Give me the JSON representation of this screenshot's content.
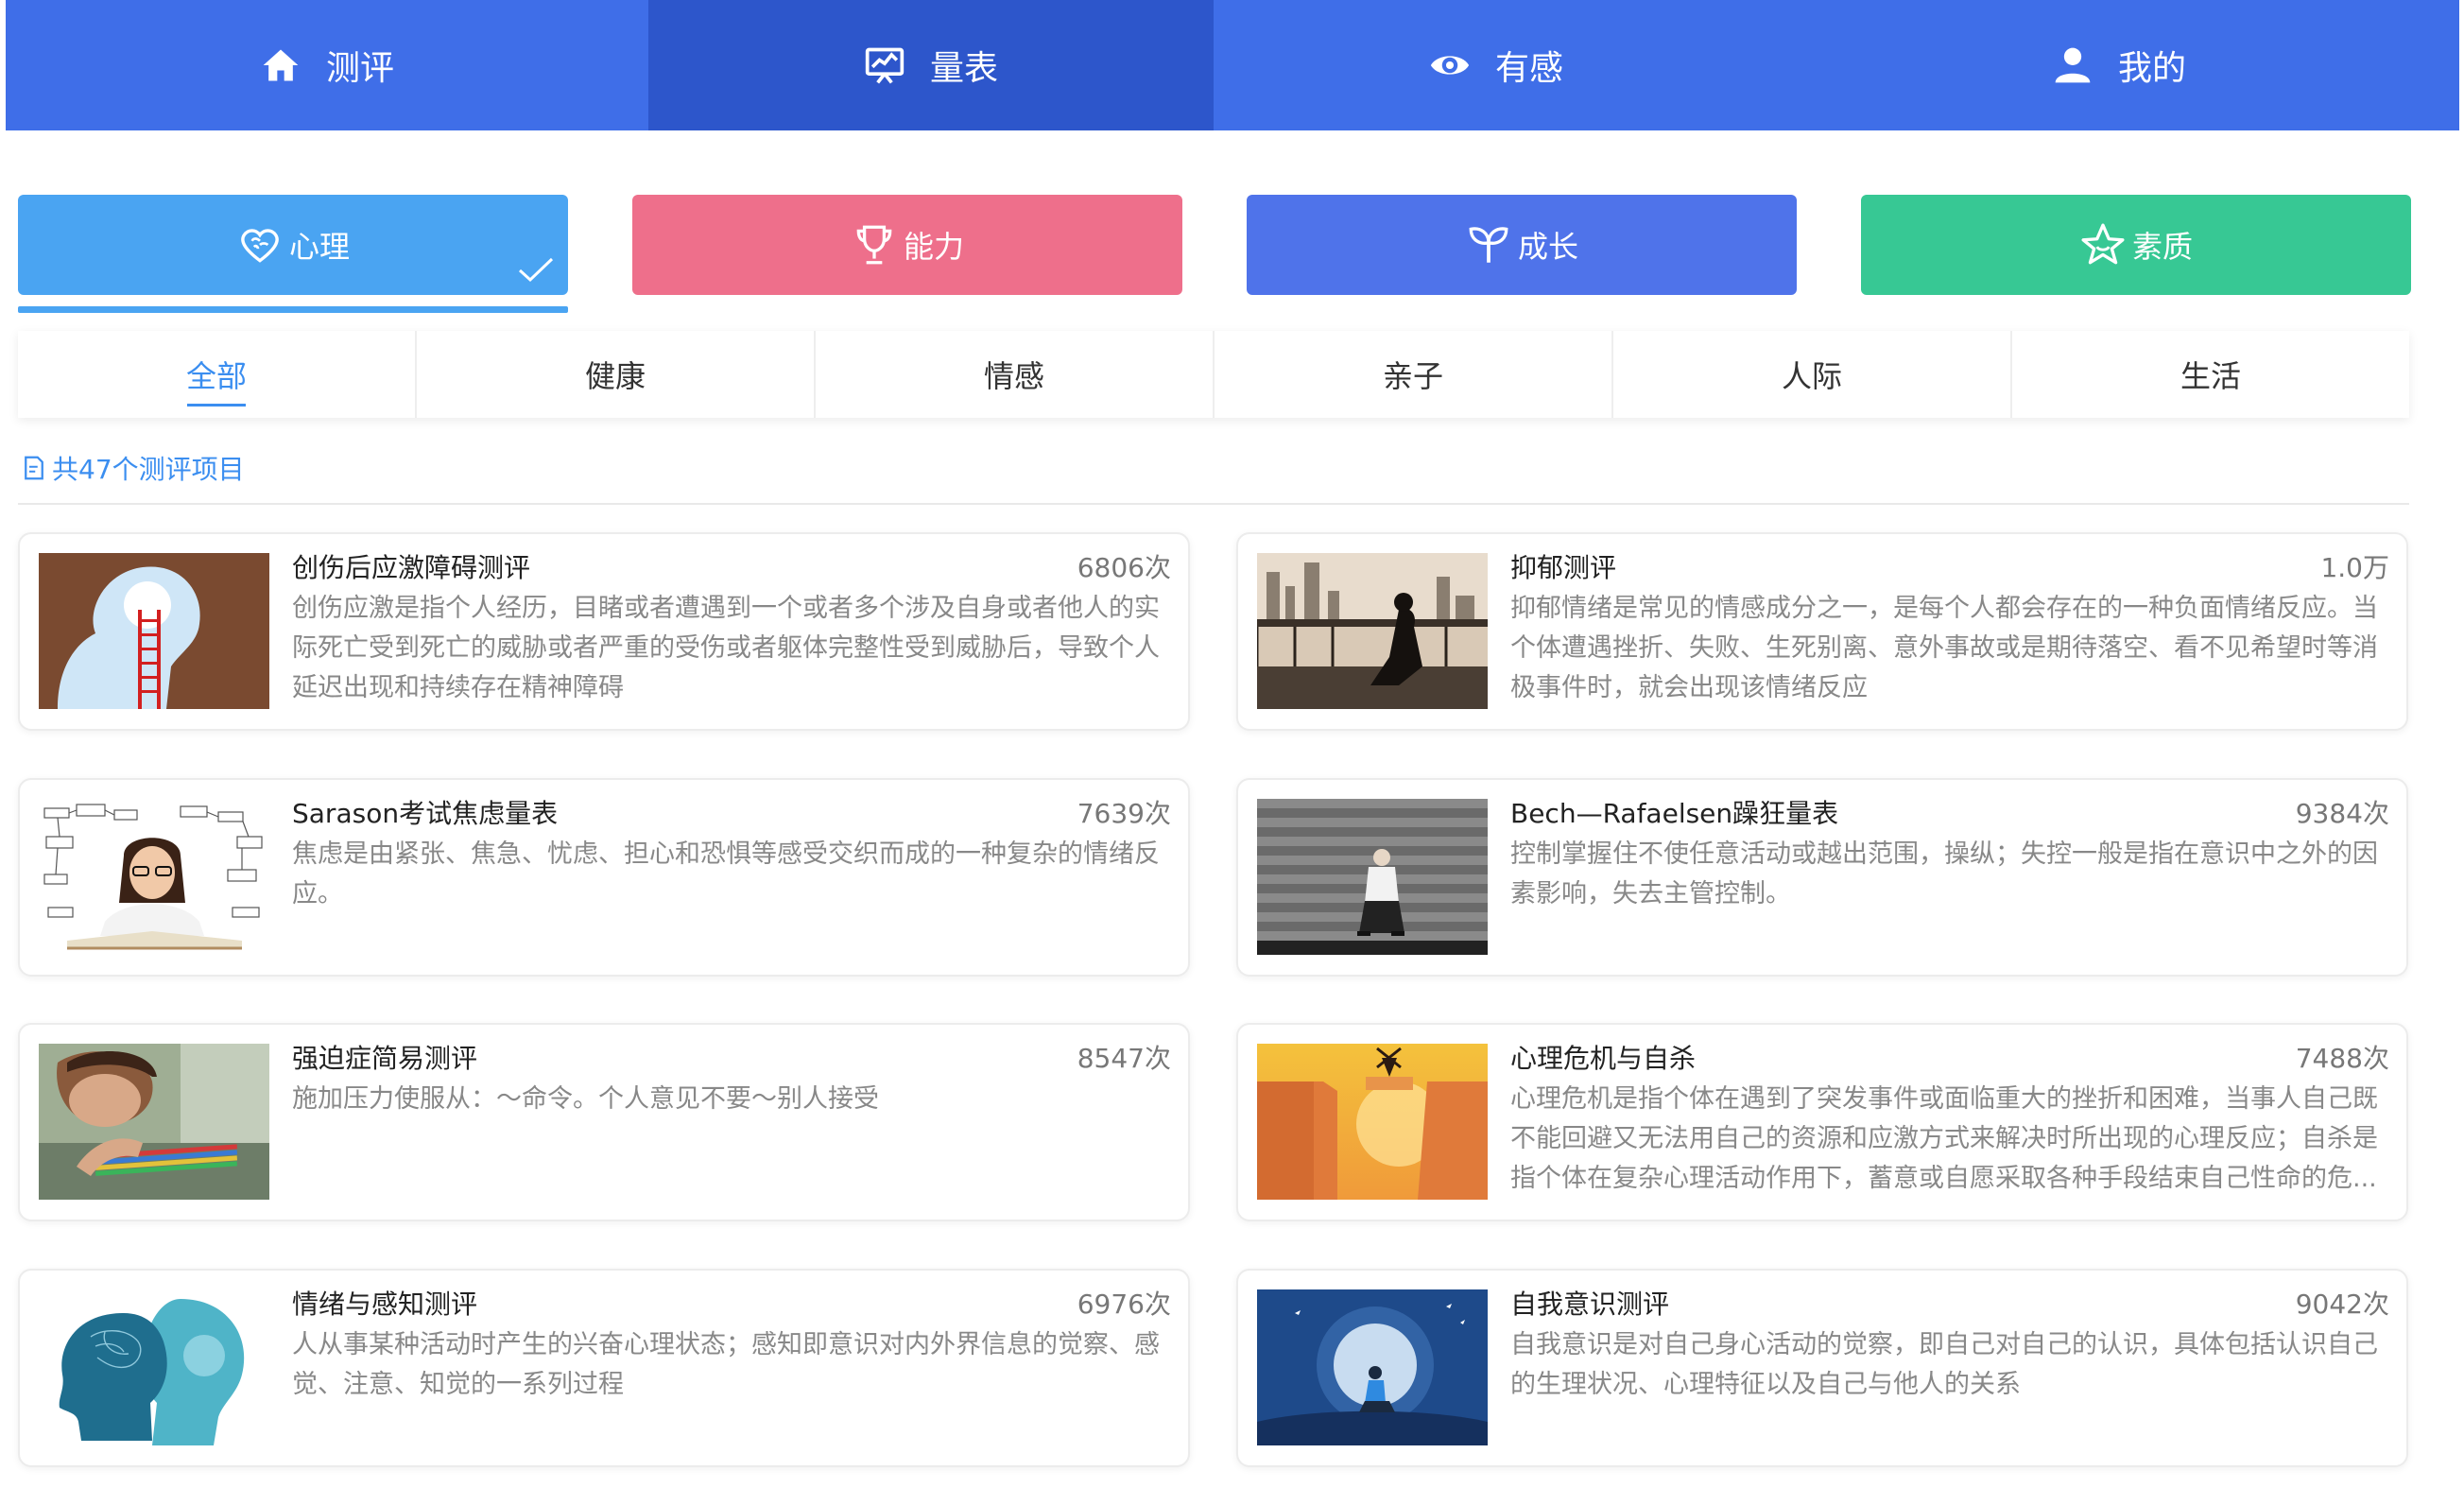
{
  "nav": [
    {
      "label": "测评",
      "icon": "home-icon",
      "active": false
    },
    {
      "label": "量表",
      "icon": "chart-board-icon",
      "active": true
    },
    {
      "label": "有感",
      "icon": "eye-icon",
      "active": false
    },
    {
      "label": "我的",
      "icon": "user-icon",
      "active": false
    }
  ],
  "categories": [
    {
      "label": "心理",
      "icon": "heart-brain-icon",
      "color": "#4aa4f2",
      "active": true
    },
    {
      "label": "能力",
      "icon": "trophy-icon",
      "color": "#ee6f8b",
      "active": false
    },
    {
      "label": "成长",
      "icon": "sprout-icon",
      "color": "#4f73ea",
      "active": false
    },
    {
      "label": "素质",
      "icon": "star-icon",
      "color": "#37c894",
      "active": false
    }
  ],
  "subtabs": [
    "全部",
    "健康",
    "情感",
    "亲子",
    "人际",
    "生活"
  ],
  "count_text": "共47个测评项目",
  "items": [
    {
      "title": "创伤后应激障碍测评",
      "views": "6806次",
      "desc": "创伤应激是指个人经历，目睹或者遭遇到一个或者多个涉及自身或者他人的实际死亡受到死亡的威胁或者严重的受伤或者躯体完整性受到威胁后，导致个人延迟出现和持续存在精神障碍"
    },
    {
      "title": "抑郁测评",
      "views": "1.0万",
      "desc": "抑郁情绪是常见的情感成分之一，是每个人都会存在的一种负面情绪反应。当个体遭遇挫折、失败、生死别离、意外事故或是期待落空、看不见希望时等消极事件时，就会出现该情绪反应"
    },
    {
      "title": "Sarason考试焦虑量表",
      "views": "7639次",
      "desc": "焦虑是由紧张、焦急、忧虑、担心和恐惧等感受交织而成的一种复杂的情绪反应。"
    },
    {
      "title": "Bech—Rafaelsen躁狂量表",
      "views": "9384次",
      "desc": "控制掌握住不使任意活动或越出范围，操纵；失控一般是指在意识中之外的因素影响，失去主管控制。"
    },
    {
      "title": "强迫症简易测评",
      "views": "8547次",
      "desc": "施加压力使服从：～命令。个人意见不要～别人接受"
    },
    {
      "title": "心理危机与自杀",
      "views": "7488次",
      "desc": "心理危机是指个体在遇到了突发事件或面临重大的挫折和困难，当事人自己既不能回避又无法用自己的资源和应激方式来解决时所出现的心理反应；自杀是指个体在复杂心理活动作用下，蓄意或自愿采取各种手段结束自己性命的危..."
    },
    {
      "title": "情绪与感知测评",
      "views": "6976次",
      "desc": "人从事某种活动时产生的兴奋心理状态；感知即意识对内外界信息的觉察、感觉、注意、知觉的一系列过程"
    },
    {
      "title": "自我意识测评",
      "views": "9042次",
      "desc": "自我意识是对自己身心活动的觉察，即自己对自己的认识，具体包括认识自己的生理状况、心理特征以及自己与他人的关系"
    }
  ]
}
